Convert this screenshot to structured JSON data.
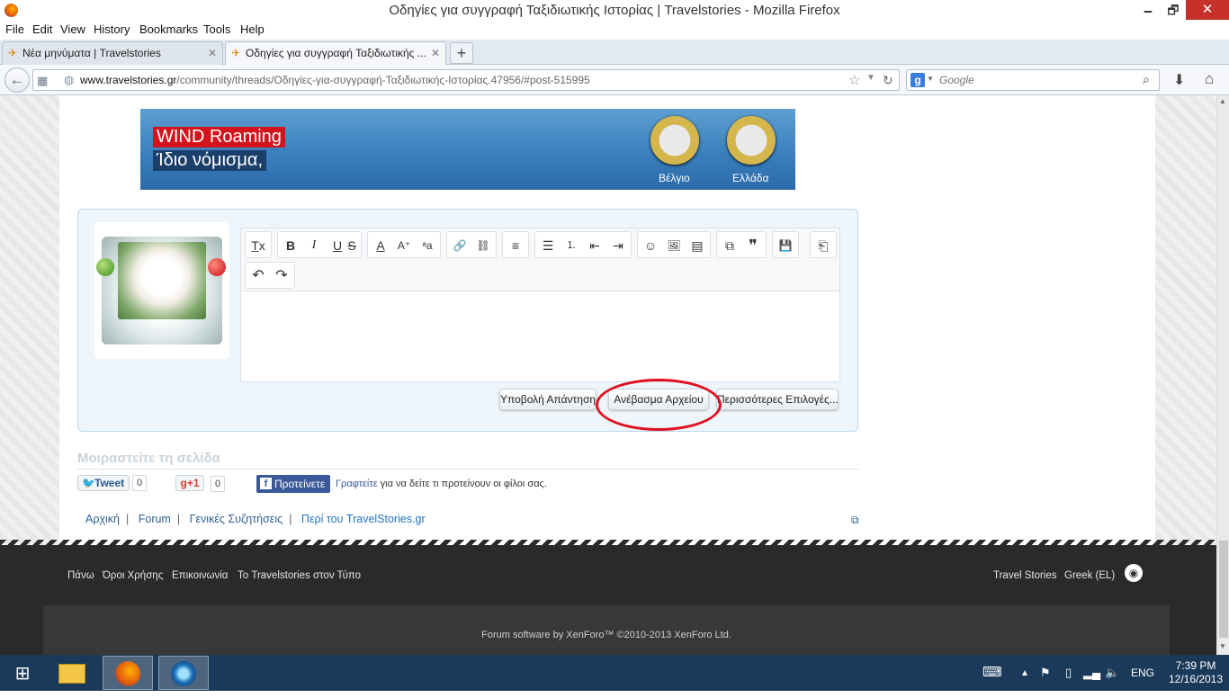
{
  "window": {
    "title": "Οδηγίες για συγγραφή Ταξιδιωτικής Ιστορίας | Travelstories - Mozilla Firefox",
    "minimize": "🗕",
    "maximize": "🗗",
    "close": "✕"
  },
  "menu": [
    "File",
    "Edit",
    "View",
    "History",
    "Bookmarks",
    "Tools",
    "Help"
  ],
  "tabs": [
    {
      "label": "Νέα μηνύματα | Travelstories",
      "close": "✕"
    },
    {
      "label": "Οδηγίες για συγγραφή Ταξιδιωτικής ...",
      "close": "✕"
    }
  ],
  "newtab": "+",
  "nav": {
    "url_host": "www.travelstories.gr",
    "url_path": "/community/threads/Οδηγίες-για-συγγραφή-Ταξιδιωτικής-Ιστορίας.47956/#post-515995",
    "search_placeholder": "Google"
  },
  "banner": {
    "line1": "WIND Roaming",
    "line2": "Ίδιο νόμισμα,",
    "coin1": "Βέλγιο",
    "coin2": "Ελλάδα"
  },
  "toolbar": {
    "row1": [
      "T̲x",
      "B",
      "I",
      "U",
      "S",
      "A",
      "A⁺",
      "ᵃa",
      "🔗",
      "⛓",
      "≡",
      "☰",
      "⒈",
      "⇤",
      "⇥",
      "☺",
      "🖼",
      "▤",
      "⧉",
      "❞",
      "💾",
      "⎗"
    ],
    "row2": [
      "↶",
      "↷"
    ]
  },
  "buttons": {
    "submit": "Υποβολή Απάντησης",
    "upload": "Ανέβασμα Αρχείου",
    "more": "Περισσότερες Επιλογές..."
  },
  "share": {
    "title": "Μοιραστείτε τη σελίδα",
    "tweet": "Tweet",
    "tweet_count": "0",
    "gplus": "g+1",
    "gplus_count": "0",
    "fb_button": "Προτείνετε",
    "fb_link": "Γραφτείτε",
    "fb_text": "για να δείτε τι προτείνουν οι φίλοι σας."
  },
  "breadcrumb": [
    "Αρχική",
    "Forum",
    "Γενικές Συζητήσεις",
    "Περί του TravelStories.gr"
  ],
  "footer": {
    "links": [
      "Πάνω",
      "Όροι Χρήσης",
      "Επικοινωνία",
      "Το Travelstories στον Τύπο"
    ],
    "right": [
      "Travel Stories",
      "Greek (EL)"
    ],
    "copyright": "Forum software by XenForo™ ©2010-2013 XenForo Ltd."
  },
  "taskbar": {
    "lang": "ENG",
    "time": "7:39 PM",
    "date": "12/16/2013"
  },
  "colors": {
    "accent_circle": "#e0101f",
    "link": "#2c5f91",
    "taskbar": "#1b3a5a"
  }
}
